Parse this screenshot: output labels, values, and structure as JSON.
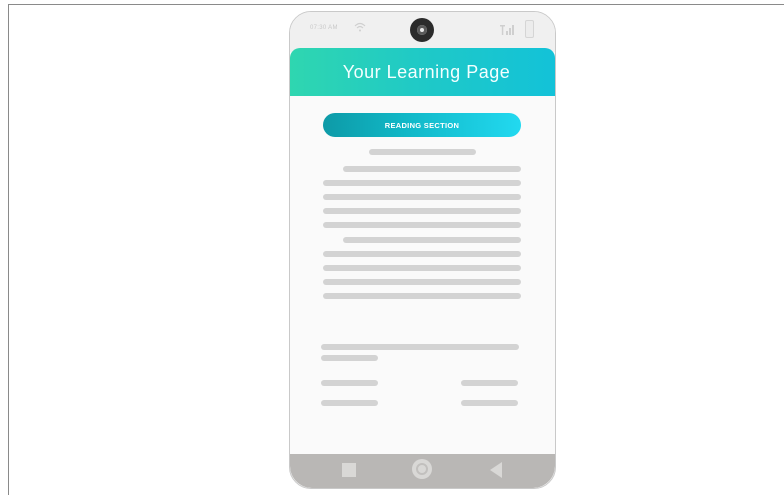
{
  "status_bar": {
    "time": "07:30 AM",
    "icons": [
      "wifi-icon",
      "signal-icon",
      "battery-icon",
      "camera-icon"
    ]
  },
  "header": {
    "title": "Your Learning Page",
    "gradient": [
      "#2fd6b0",
      "#13c2d8"
    ]
  },
  "reading_button": {
    "label": "READING SECTION",
    "gradient": [
      "#0e9aa7",
      "#22d9f0"
    ]
  },
  "nav_bar": {
    "icons": [
      "recent-apps-icon",
      "home-icon",
      "back-icon"
    ]
  },
  "colors": {
    "placeholder": "#d3d3d3",
    "nav_background": "#b9b7b5"
  }
}
